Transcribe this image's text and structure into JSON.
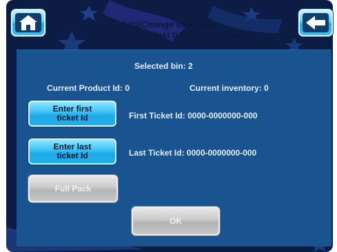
{
  "header": {
    "title": "Add/Change Inventory",
    "subtitle": "Scan first and last ticket in the pack"
  },
  "icons": {
    "home": "home-icon",
    "back": "back-arrow-icon"
  },
  "info": {
    "selected_bin": "Selected bin: 2",
    "current_product": "Current Product Id: 0",
    "current_inventory": "Current inventory: 0",
    "first_ticket": "First Ticket Id: 0000-0000000-000",
    "last_ticket": "Last Ticket Id: 0000-0000000-000"
  },
  "buttons": {
    "enter_first_line1": "Enter first",
    "enter_first_line2": "ticket Id",
    "enter_last_line1": "Enter last",
    "enter_last_line2": "ticket Id",
    "full_pack": "Full Pack",
    "ok": "OK"
  },
  "colors": {
    "panel": "#1a5490",
    "bezel": "#0c1c44",
    "button_blue": "#44c6f7",
    "button_disabled": "#c9c9c9"
  }
}
